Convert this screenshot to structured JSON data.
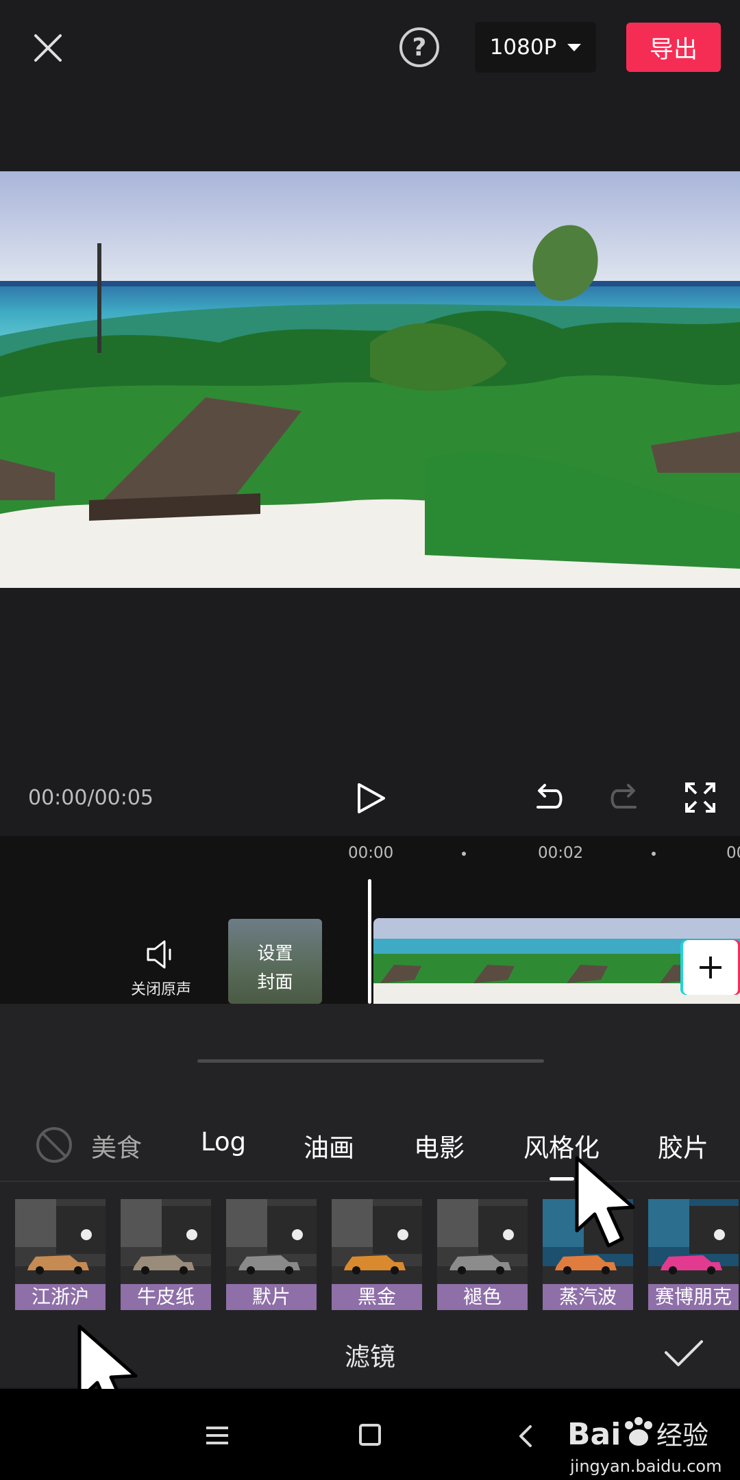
{
  "topbar": {
    "close_icon": "close-icon",
    "help_label": "?",
    "resolution": "1080P",
    "export_label": "导出"
  },
  "playback": {
    "timecode": "00:00/00:05"
  },
  "timeline": {
    "ruler": [
      "00:00",
      "00:02",
      "00"
    ],
    "mute_label": "关闭原声",
    "cover_label": "设置\n封面"
  },
  "filter_panel": {
    "categories": [
      "美食",
      "Log",
      "油画",
      "电影",
      "风格化",
      "胶片"
    ],
    "active_category": "风格化",
    "filters": [
      {
        "label": "江浙沪",
        "tint": "#c58b52"
      },
      {
        "label": "牛皮纸",
        "tint": "#9a8c7a"
      },
      {
        "label": "默片",
        "tint": "#8a8a8a"
      },
      {
        "label": "黑金",
        "tint": "#d98a2e"
      },
      {
        "label": "褪色",
        "tint": "#8c8c8c"
      },
      {
        "label": "蒸汽波",
        "tint": "#e07c3e"
      },
      {
        "label": "赛博朋克",
        "tint": "#e23a8e"
      }
    ],
    "title": "滤镜"
  },
  "watermark": {
    "brand": "Bai",
    "brand_suffix": "经验",
    "url": "jingyan.baidu.com"
  }
}
